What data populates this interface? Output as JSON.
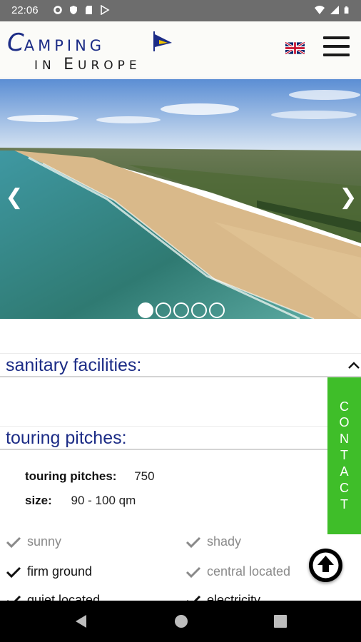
{
  "status_bar": {
    "time": "22:06",
    "icons_left": [
      "gear-icon",
      "shield-icon",
      "sd-card-icon",
      "play-store-icon"
    ],
    "icons_right": [
      "wifi-icon",
      "signal-icon",
      "battery-icon"
    ]
  },
  "header": {
    "logo_line1_initial": "C",
    "logo_line1_rest": "AMPING",
    "logo_line2_a": "IN ",
    "logo_line2_b": "E",
    "logo_line2_c": "UROPE",
    "language_flag": "uk-flag-icon",
    "menu_icon": "hamburger-menu-icon"
  },
  "carousel": {
    "prev_arrow": "❮",
    "next_arrow": "❯",
    "slides": 5,
    "active_slide": 1
  },
  "sections": {
    "sanitary": {
      "title": "sanitary facilities:"
    },
    "touring": {
      "title": "touring pitches:"
    }
  },
  "touring_details": {
    "pitches_label": "touring pitches:",
    "pitches_value": "750",
    "size_label": "size:",
    "size_value": "90 - 100 qm"
  },
  "features": [
    {
      "label": "sunny",
      "checked": false
    },
    {
      "label": "shady",
      "checked": false
    },
    {
      "label": "firm ground",
      "checked": true
    },
    {
      "label": "central located",
      "checked": false
    },
    {
      "label": "quiet located",
      "checked": true
    },
    {
      "label": "electricity",
      "checked": true
    }
  ],
  "contact_tab": {
    "letters": [
      "C",
      "O",
      "N",
      "T",
      "A",
      "C",
      "T"
    ]
  },
  "colors": {
    "brand_blue": "#1c2c86",
    "contact_green": "#3fbe29",
    "status_bar": "#6d6d6d"
  }
}
